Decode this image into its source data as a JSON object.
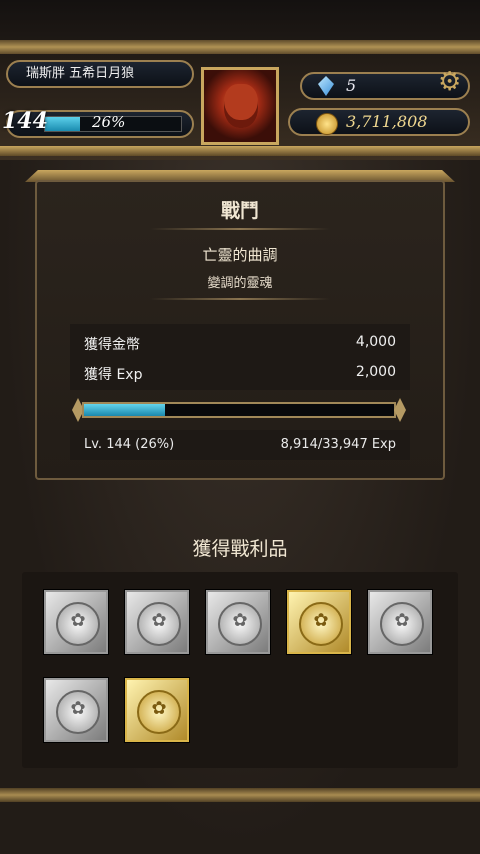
{
  "header": {
    "player_name": "瑞斯胖 五希日月狼",
    "level": "144",
    "level_percent": "26%",
    "level_progress": 0.26,
    "gems": "5",
    "gold": "3,711,808"
  },
  "battle": {
    "title": "戰鬥",
    "stage_name": "亡靈的曲調",
    "stage_subtitle": "變調的靈魂",
    "coins_label": "獲得金幣",
    "coins_value": "4,000",
    "exp_label": "獲得 Exp",
    "exp_value": "2,000",
    "exp_progress": 0.26,
    "level_text": "Lv. 144 (26%)",
    "exp_text": "8,914/33,947 Exp"
  },
  "loot": {
    "title": "獲得戰利品",
    "items": [
      {
        "type": "silver-coin-card"
      },
      {
        "type": "silver-coin-card"
      },
      {
        "type": "silver-coin-card"
      },
      {
        "type": "gold-coin-card"
      },
      {
        "type": "silver-coin-card"
      },
      {
        "type": "silver-coin-card"
      },
      {
        "type": "gold-coin-card"
      }
    ]
  },
  "icons": {
    "gem": "gem-icon",
    "gold": "coin-icon",
    "settings": "gear-icon"
  },
  "colors": {
    "accent_gold": "#c9a75f",
    "exp_bar": "#1a88ad"
  }
}
